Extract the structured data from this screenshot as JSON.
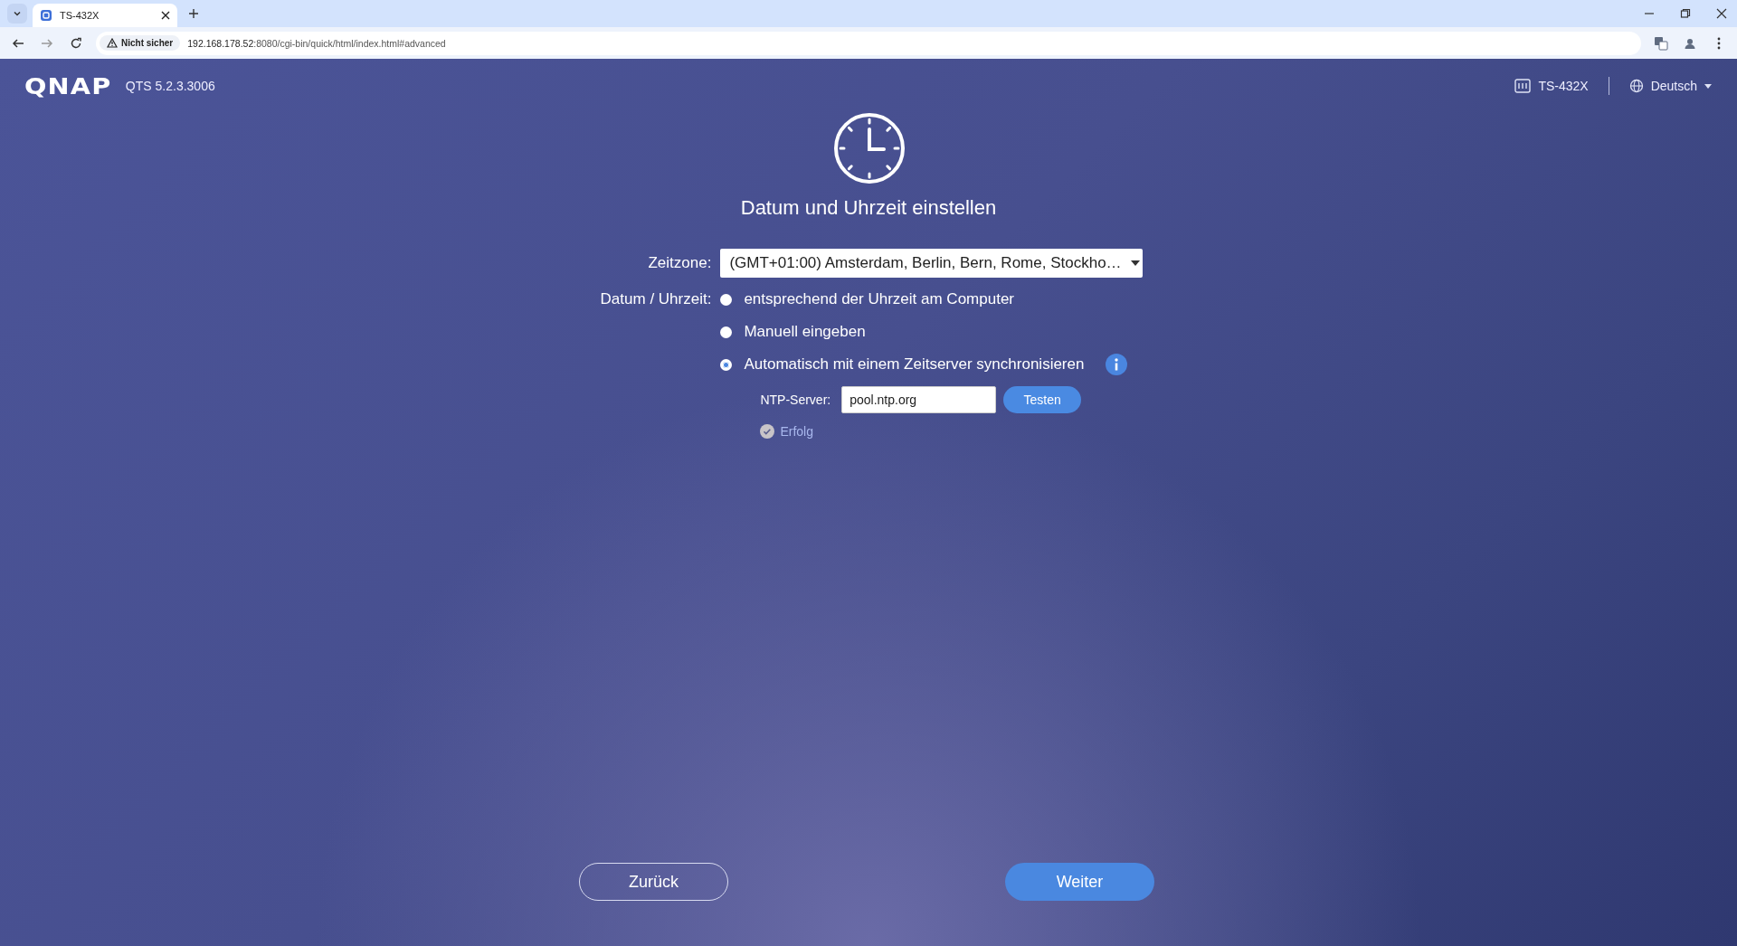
{
  "browser": {
    "tabs": [
      {
        "title": "TS-432X",
        "selected": true
      }
    ],
    "address": {
      "security": "Nicht sicher",
      "host": "192.168.178.52",
      "path": ":8080/cgi-bin/quick/html/index.html#advanced"
    }
  },
  "header": {
    "brand": "QNAP",
    "version": "QTS 5.2.3.3006",
    "device": "TS-432X",
    "language": "Deutsch"
  },
  "title": "Datum und Uhrzeit einstellen",
  "timezone": {
    "label": "Zeitzone:",
    "value": "(GMT+01:00) Amsterdam, Berlin, Bern, Rome, Stockho…"
  },
  "datetime": {
    "label": "Datum / Uhrzeit:",
    "options": [
      {
        "label": "entsprechend der Uhrzeit am Computer",
        "selected": false
      },
      {
        "label": "Manuell eingeben",
        "selected": false
      },
      {
        "label": "Automatisch mit einem Zeitserver synchronisieren",
        "selected": true,
        "info": true
      }
    ]
  },
  "ntp": {
    "label": "NTP-Server:",
    "value": "pool.ntp.org",
    "button": "Testen",
    "result": "Erfolg"
  },
  "buttons": [
    {
      "label": "Zurück",
      "kind": "secondary"
    },
    {
      "label": "Weiter",
      "kind": "primary"
    }
  ]
}
